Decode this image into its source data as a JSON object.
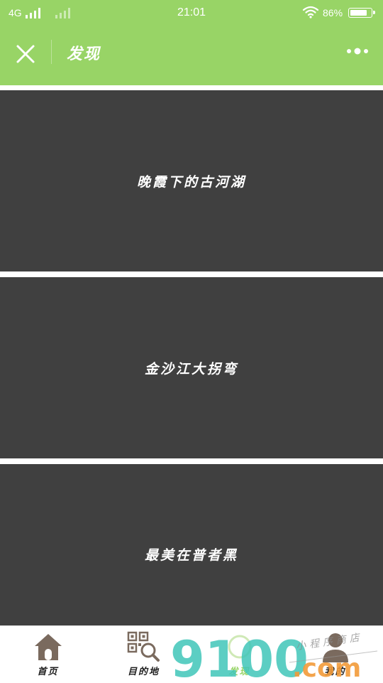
{
  "status_bar": {
    "network": "4G",
    "time": "21:01",
    "battery_percent": "86%",
    "battery_level": 0.86,
    "icons": [
      "signal-icon",
      "wifi-icon",
      "battery-icon"
    ]
  },
  "nav_bar": {
    "title": "发现",
    "close_icon": "close-icon",
    "more_icon": "more-icon"
  },
  "cards": [
    {
      "caption": "晚霞下的古河湖"
    },
    {
      "caption": "金沙江大拐弯"
    },
    {
      "caption": "最美在普者黑"
    }
  ],
  "tab_bar": {
    "tabs": [
      {
        "label": "首页",
        "icon": "house-icon"
      },
      {
        "label": "目的地",
        "icon": "qr-search-icon"
      },
      {
        "label": "发现",
        "icon": "discover-icon",
        "active": true
      },
      {
        "label": "我的",
        "icon": "user-icon"
      }
    ]
  },
  "watermark": {
    "number": "9100",
    "suffix": ".com",
    "tagline": "小程序商店"
  },
  "colors": {
    "brand_green": "#98d466",
    "card_bg": "#404040",
    "icon_brown": "#7a6a5e",
    "watermark_teal": "#3fc6b8",
    "watermark_orange": "#f29a38"
  }
}
